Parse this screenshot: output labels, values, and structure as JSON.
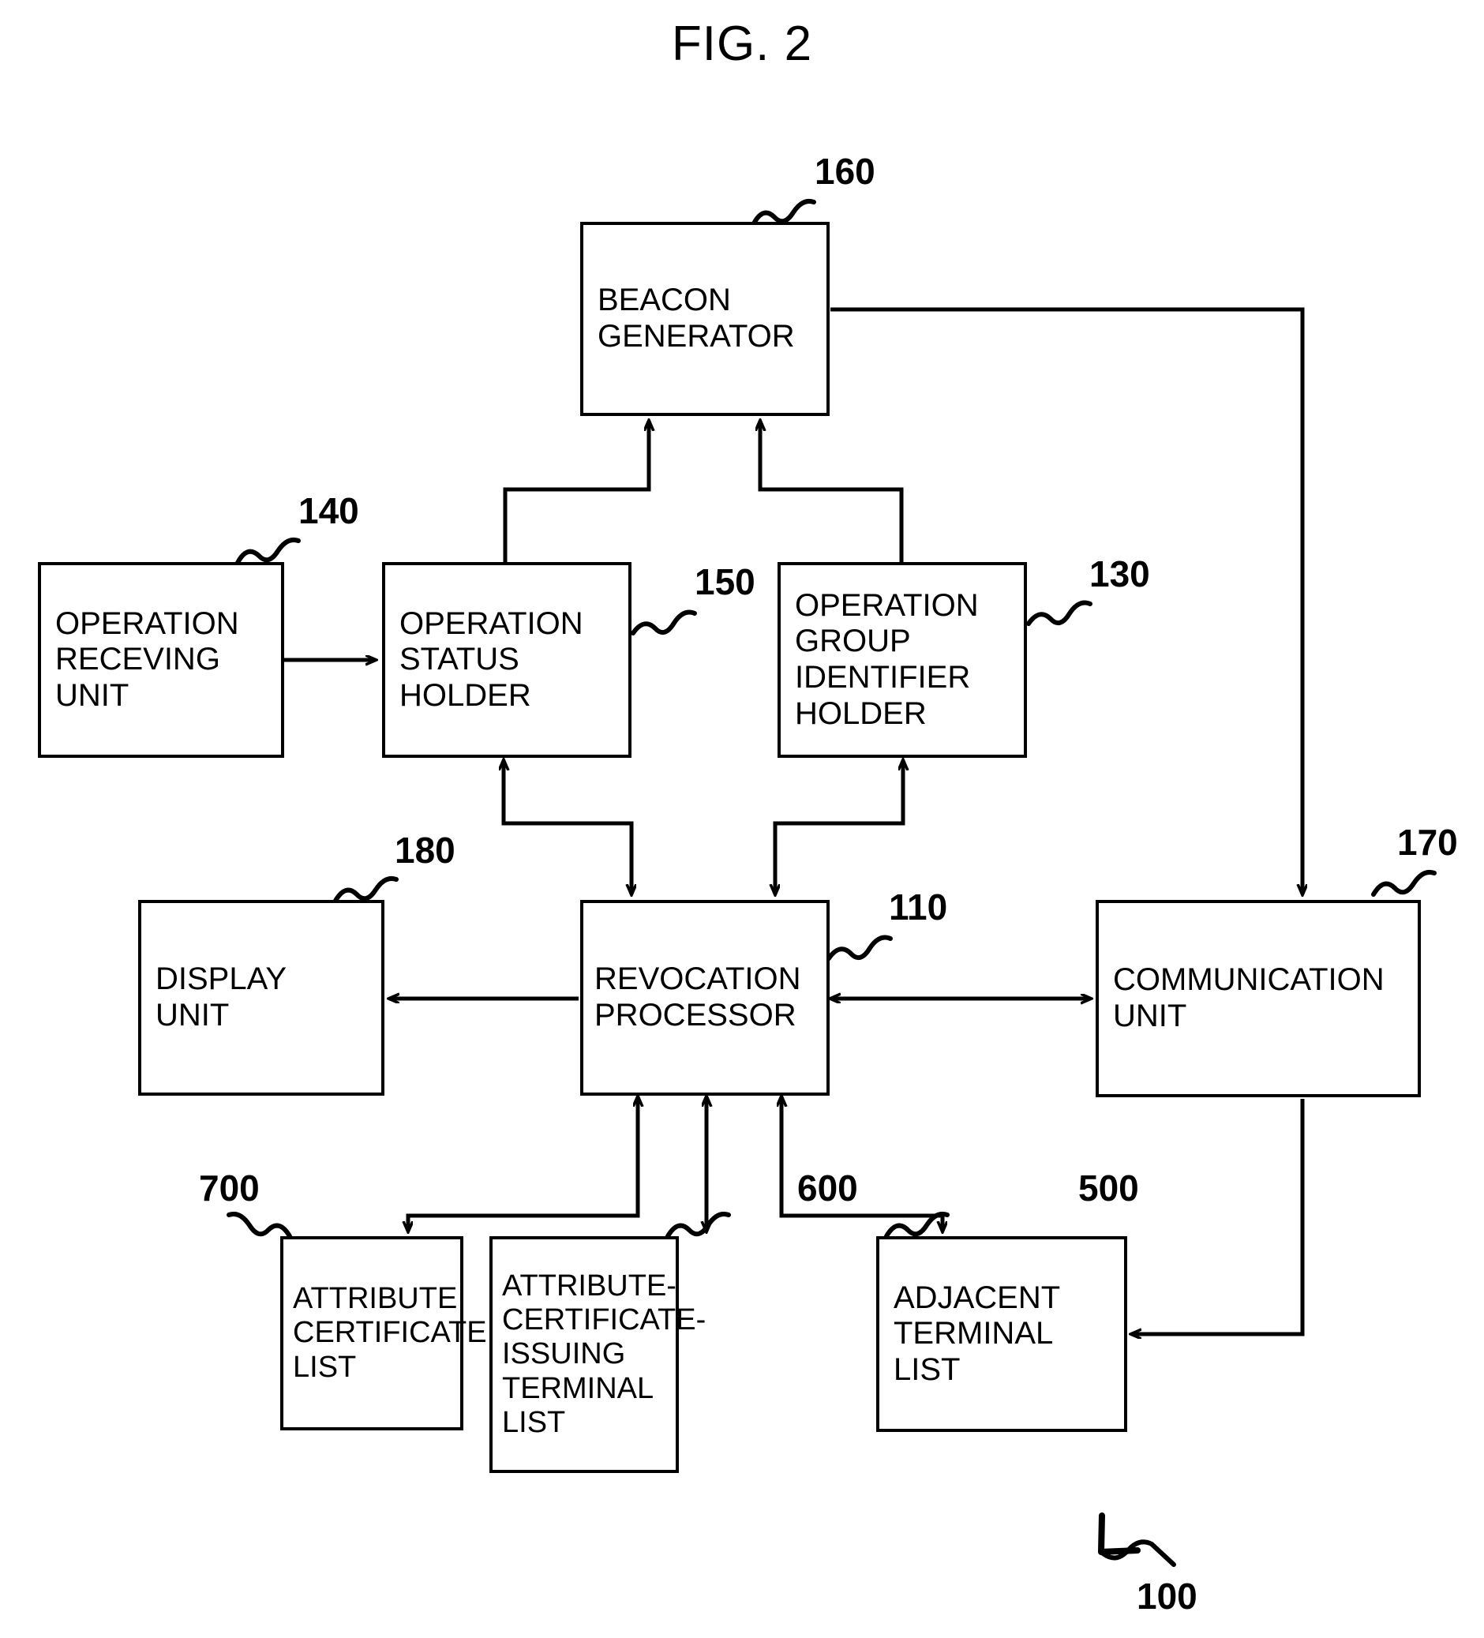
{
  "figure": {
    "title": "FIG. 2",
    "system_ref": "100"
  },
  "nodes": [
    {
      "id": "beacon-generator",
      "label": "BEACON\nGENERATOR",
      "ref": "160"
    },
    {
      "id": "operation-receiving-unit",
      "label": "OPERATION\nRECEVING\nUNIT",
      "ref": "140"
    },
    {
      "id": "operation-status-holder",
      "label": "OPERATION\nSTATUS\nHOLDER",
      "ref": "150"
    },
    {
      "id": "operation-group-identifier-holder",
      "label": "OPERATION\nGROUP\nIDENTIFIER\nHOLDER",
      "ref": "130"
    },
    {
      "id": "display-unit",
      "label": "DISPLAY\nUNIT",
      "ref": "180"
    },
    {
      "id": "revocation-processor",
      "label": "REVOCATION\nPROCESSOR",
      "ref": "110"
    },
    {
      "id": "communication-unit",
      "label": "COMMUNICATION\nUNIT",
      "ref": "170"
    },
    {
      "id": "attribute-certificate-list",
      "label": "ATTRIBUTE\nCERTIFICATE\nLIST",
      "ref": "700"
    },
    {
      "id": "attribute-certificate-issuing-terminal-list",
      "label": "ATTRIBUTE-\nCERTIFICATE-\nISSUING\nTERMINAL\nLIST",
      "ref": "600"
    },
    {
      "id": "adjacent-terminal-list",
      "label": "ADJACENT\nTERMINAL\nLIST",
      "ref": "500"
    }
  ],
  "chart_data": {
    "type": "diagram",
    "title": "FIG. 2",
    "description": "Block diagram of terminal 100 showing revocation processor and peripheral units",
    "blocks": [
      {
        "ref": "160",
        "name": "BEACON GENERATOR"
      },
      {
        "ref": "140",
        "name": "OPERATION RECEVING UNIT"
      },
      {
        "ref": "150",
        "name": "OPERATION STATUS HOLDER"
      },
      {
        "ref": "130",
        "name": "OPERATION GROUP IDENTIFIER HOLDER"
      },
      {
        "ref": "180",
        "name": "DISPLAY UNIT"
      },
      {
        "ref": "110",
        "name": "REVOCATION PROCESSOR"
      },
      {
        "ref": "170",
        "name": "COMMUNICATION UNIT"
      },
      {
        "ref": "700",
        "name": "ATTRIBUTE CERTIFICATE LIST"
      },
      {
        "ref": "600",
        "name": "ATTRIBUTE-CERTIFICATE-ISSUING TERMINAL LIST"
      },
      {
        "ref": "500",
        "name": "ADJACENT TERMINAL LIST"
      },
      {
        "ref": "100",
        "name": "TERMINAL (overall system)"
      }
    ],
    "edges": [
      {
        "from": "140",
        "to": "150",
        "arrow": "single"
      },
      {
        "from": "150",
        "to": "160",
        "arrow": "single"
      },
      {
        "from": "130",
        "to": "160",
        "arrow": "single"
      },
      {
        "from": "110",
        "to": "150",
        "arrow": "double"
      },
      {
        "from": "110",
        "to": "130",
        "arrow": "double"
      },
      {
        "from": "110",
        "to": "180",
        "arrow": "single"
      },
      {
        "from": "110",
        "to": "170",
        "arrow": "double"
      },
      {
        "from": "160",
        "to": "170",
        "arrow": "single"
      },
      {
        "from": "110",
        "to": "700",
        "arrow": "double"
      },
      {
        "from": "110",
        "to": "600",
        "arrow": "double"
      },
      {
        "from": "110",
        "to": "500",
        "arrow": "double"
      },
      {
        "from": "170",
        "to": "500",
        "arrow": "single"
      }
    ]
  }
}
